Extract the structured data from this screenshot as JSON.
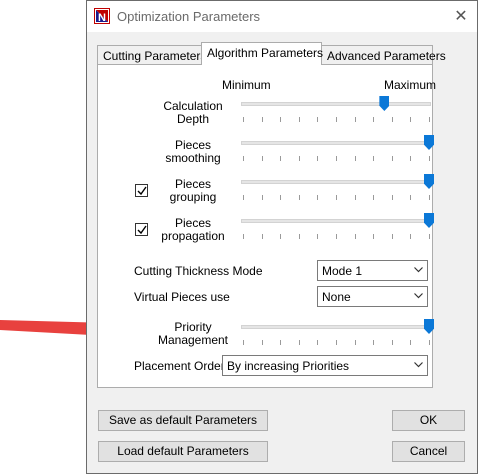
{
  "window": {
    "title": "Optimization Parameters",
    "icon": "app-logo-icon",
    "close_icon": "close-icon"
  },
  "tabs": [
    {
      "label": "Cutting Parameters",
      "active": false
    },
    {
      "label": "Algorithm Parameters",
      "active": true
    },
    {
      "label": "Advanced Parameters",
      "active": false
    }
  ],
  "scale": {
    "min_label": "Minimum",
    "max_label": "Maximum"
  },
  "sliders": [
    {
      "line1": "Calculation",
      "line2": "Depth",
      "value": 0.76
    },
    {
      "line1": "Pieces",
      "line2": "smoothing",
      "value": 1.0
    },
    {
      "line1": "Pieces",
      "line2": "grouping",
      "value": 1.0,
      "checked": true
    },
    {
      "line1": "Pieces",
      "line2": "propagation",
      "value": 1.0,
      "checked": true
    }
  ],
  "cutting_thickness": {
    "label": "Cutting Thickness Mode",
    "value": "Mode 1"
  },
  "virtual_pieces": {
    "label": "Virtual Pieces use",
    "value": "None"
  },
  "priority": {
    "line1": "Priority",
    "line2": "Management",
    "value": 1.0
  },
  "placement_order": {
    "label": "Placement Order",
    "value": "By increasing Priorities"
  },
  "buttons": {
    "save_default": "Save as default Parameters",
    "load_default": "Load default Parameters",
    "ok": "OK",
    "cancel": "Cancel"
  },
  "colors": {
    "accent": "#0b78d7",
    "annotation_arrow": "#e8413e"
  }
}
